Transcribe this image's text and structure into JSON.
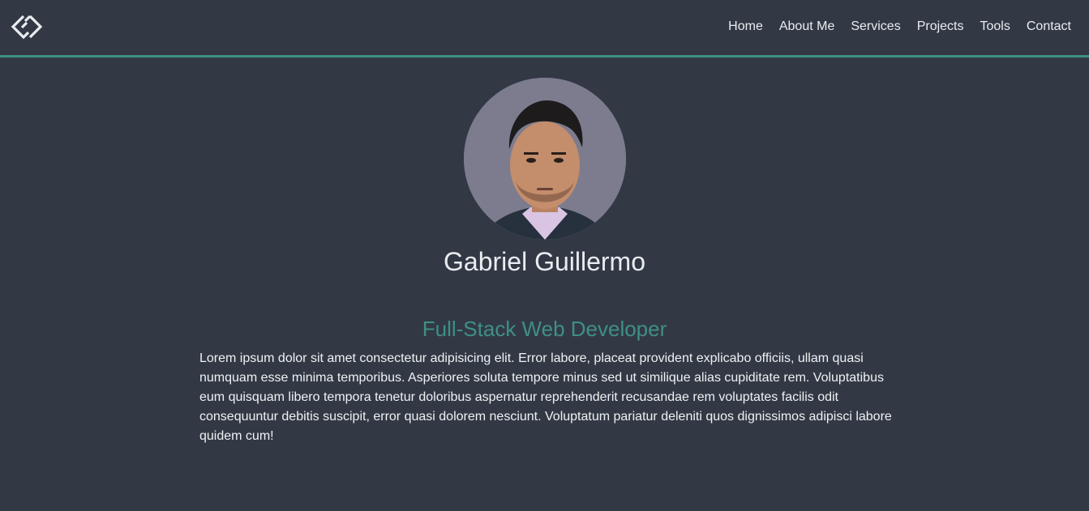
{
  "nav": {
    "logo_icon": "gg-diamond-logo-icon",
    "links": [
      "Home",
      "About Me",
      "Services",
      "Projects",
      "Tools",
      "Contact"
    ]
  },
  "profile": {
    "avatar_icon": "profile-photo",
    "name": "Gabriel Guillermo",
    "role": "Full-Stack Web Developer",
    "bio": "Lorem ipsum dolor sit amet consectetur adipisicing elit. Error labore, placeat provident explicabo officiis, ullam quasi numquam esse minima temporibus. Asperiores soluta tempore minus sed ut similique alias cupiditate rem. Voluptatibus eum quisquam libero tempora tenetur doloribus aspernatur reprehenderit recusandae rem voluptates facilis odit consequuntur debitis suscipit, error quasi dolorem nesciunt. Voluptatum pariatur deleniti quos dignissimos adipisci labore quidem cum!"
  },
  "colors": {
    "background": "#323945",
    "accent": "#3f8f85",
    "text": "#e8edf0",
    "avatar_bg": "#7c7c8e"
  }
}
